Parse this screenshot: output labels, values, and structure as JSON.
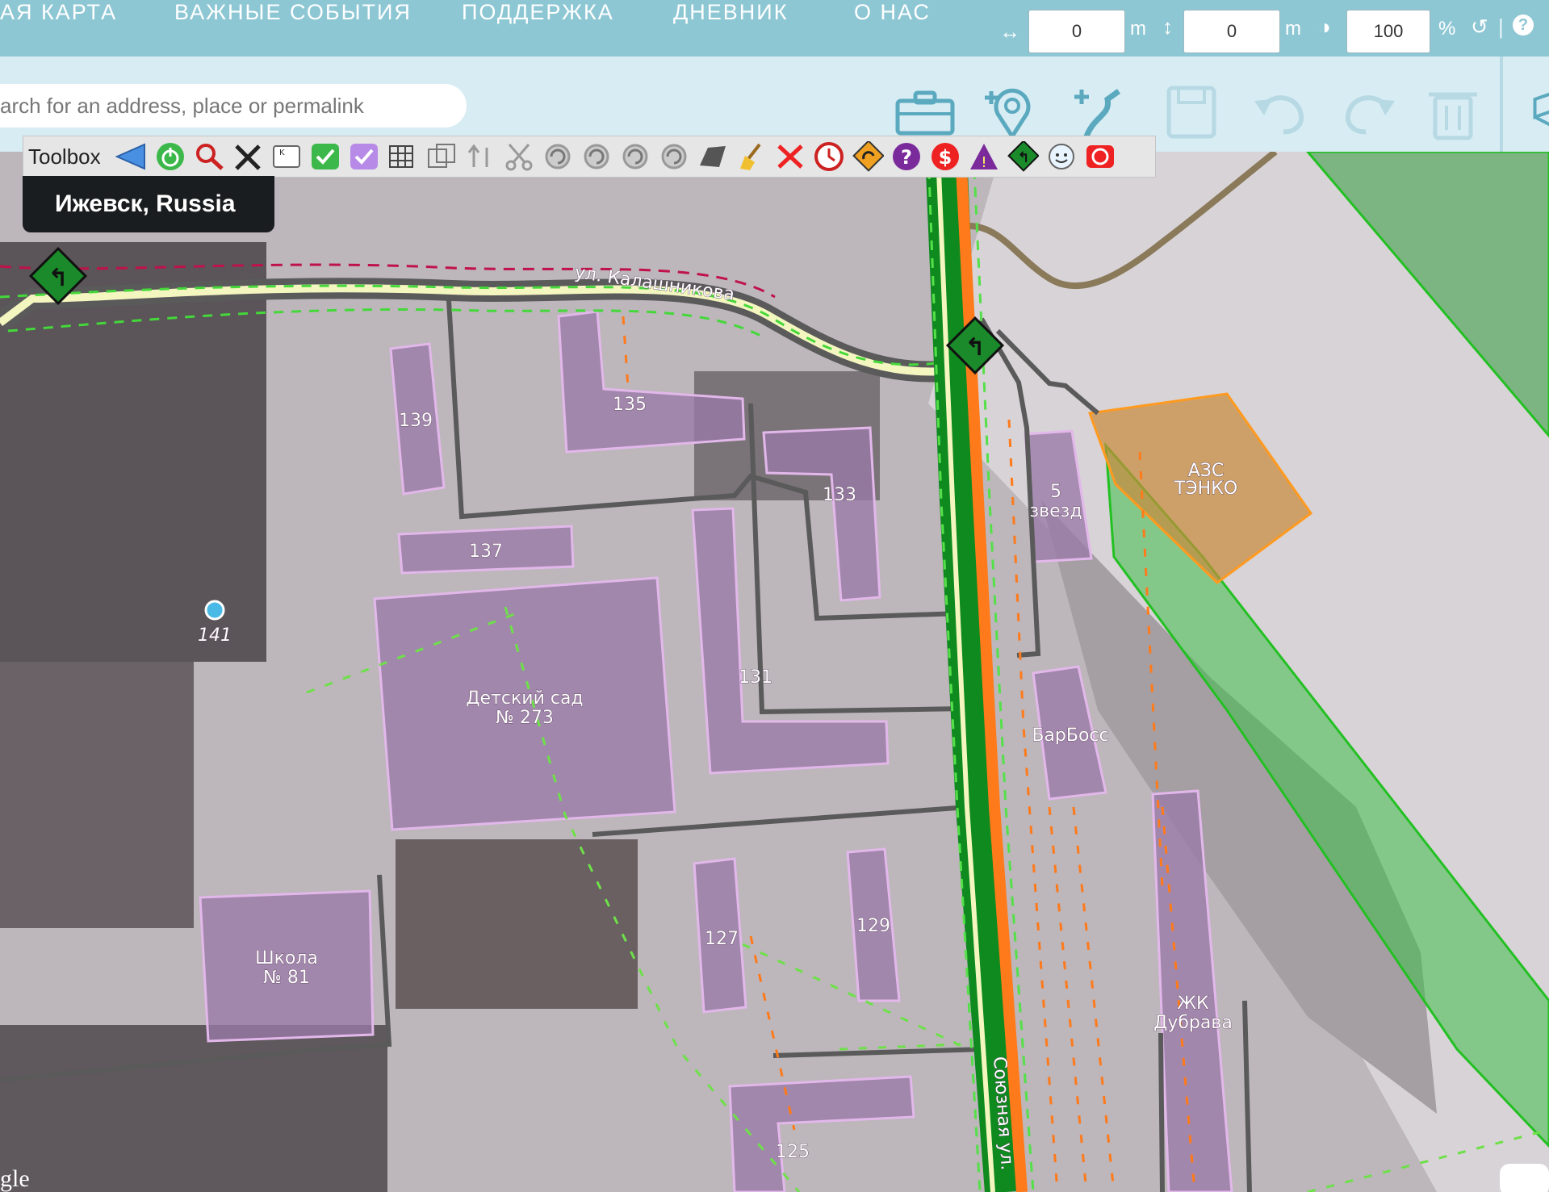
{
  "nav": {
    "links": [
      "АЯ КАРТА",
      "ВАЖНЫЕ СОБЫТИЯ",
      "ПОДДЕРЖКА",
      "ДНЕВНИК",
      "О НАС"
    ],
    "shift_x_value": "0",
    "shift_x_unit": "m",
    "shift_y_value": "0",
    "shift_y_unit": "m",
    "opacity_value": "100",
    "opacity_unit": "%"
  },
  "search": {
    "placeholder": "arch for an address, place or permalink"
  },
  "toolbox": {
    "label": "Toolbox"
  },
  "map": {
    "city": "Ижевск, Russia",
    "labels": {
      "b139": "139",
      "b135": "135",
      "b133": "133",
      "b137": "137",
      "b131": "131",
      "b129": "129",
      "b127": "127",
      "b125": "125",
      "school_line1": "Школа",
      "school_line2": "№ 81",
      "kinder_line1": "Детский сад",
      "kinder_line2": "№ 273",
      "stars_line1": "5",
      "stars_line2": "звезд",
      "azs_line1": "АЗС",
      "azs_line2": "ТЭНКО",
      "barboss": "БарБосс",
      "dubrava_line1": "ЖК",
      "dubrava_line2": "Дубрава",
      "place141": "141",
      "street_kalashnikov": "ул. Калашникова",
      "street_soyuznaya": "Союзная ул.",
      "google": "gle"
    }
  },
  "colors": {
    "nav_bg": "#8ec7d4",
    "toolbar_bg": "#d7ecf3",
    "building": "#9a7aa8",
    "forest": "#3fbf4a",
    "gas_station": "#c98a3a",
    "road_main": "#ff7a1a",
    "road_green": "#1e9a2a"
  }
}
